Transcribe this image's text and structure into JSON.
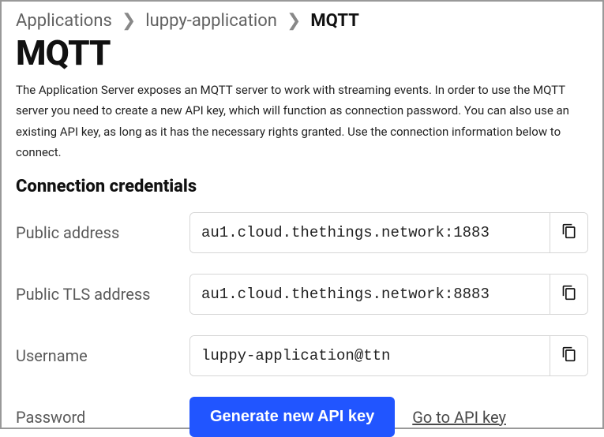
{
  "breadcrumb": {
    "items": [
      "Applications",
      "luppy-application",
      "MQTT"
    ]
  },
  "page": {
    "title": "MQTT",
    "description": "The Application Server exposes an MQTT server to work with streaming events. In order to use the MQTT server you need to create a new API key, which will function as connection password. You can also use an existing API key, as long as it has the necessary rights granted. Use the connection information below to connect."
  },
  "section": {
    "credentials_heading": "Connection credentials"
  },
  "fields": {
    "public_address": {
      "label": "Public address",
      "value": "au1.cloud.thethings.network:1883"
    },
    "public_tls_address": {
      "label": "Public TLS address",
      "value": "au1.cloud.thethings.network:8883"
    },
    "username": {
      "label": "Username",
      "value": "luppy-application@ttn"
    },
    "password": {
      "label": "Password",
      "generate_label": "Generate new API key",
      "goto_label": "Go to API key"
    }
  }
}
